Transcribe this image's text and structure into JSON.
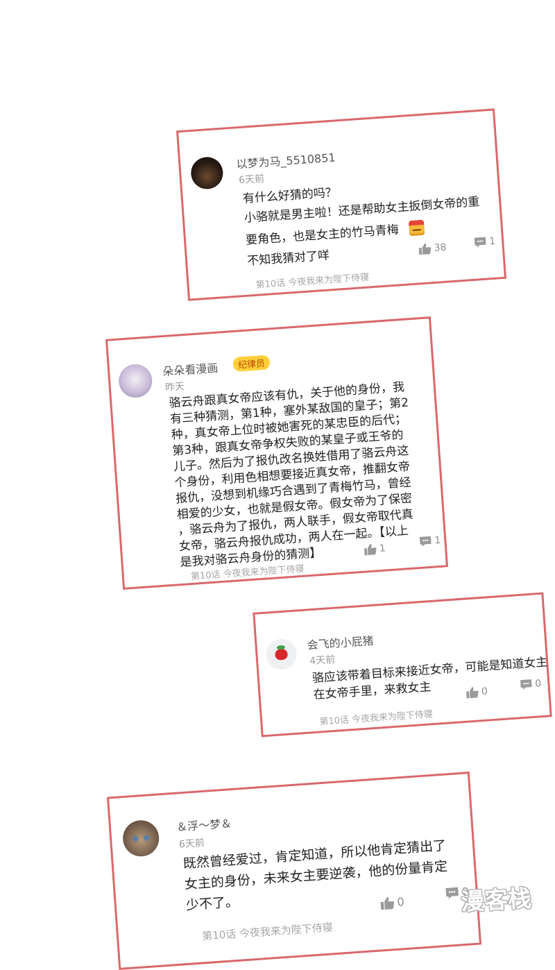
{
  "comments": [
    {
      "username": "以梦为马_5510851",
      "time": "6天前",
      "lines": [
        "有什么好猜的吗？",
        "小骆就是男主啦！还是帮助女主扳倒女帝的重",
        "要角色，也是女主的竹马青梅",
        "不知我猜对了咩"
      ],
      "emoji": "smirk-emoji",
      "chapter": "第10话 今夜我来为陛下侍寝",
      "likes": "38",
      "replies": "1"
    },
    {
      "username": "朵朵看漫画",
      "badge": "纪律员",
      "time": "昨天",
      "lines": [
        "骆云舟跟真女帝应该有仇，关于他的身份，我",
        "有三种猜测，第1种，塞外某敌国的皇子；第2",
        "种，真女帝上位时被她害死的某忠臣的后代；",
        "第3种，跟真女帝争权失败的某皇子或王爷的",
        "儿子。然后为了报仇改名换姓借用了骆云舟这",
        "个身份，利用色相想要接近真女帝，推翻女帝",
        "报仇，没想到机缘巧合遇到了青梅竹马，曾经",
        "相爱的少女，也就是假女帝。假女帝为了保密",
        "，骆云舟为了报仇，两人联手，假女帝取代真",
        "女帝，骆云舟报仇成功，两人在一起。【以上",
        "是我对骆云舟身份的猜测】"
      ],
      "chapter": "第10话 今夜我来为陛下侍寝",
      "likes": "1",
      "replies": "1"
    },
    {
      "username": "会飞的小屁猪",
      "time": "4天前",
      "lines": [
        "骆应该带着目标来接近女帝，可能是知道女主",
        "在女帝手里，来救女主"
      ],
      "chapter": "第10话 今夜我来为陛下侍寝",
      "likes": "0",
      "replies": "0"
    },
    {
      "username": "＆浮～梦＆",
      "time": "6天前",
      "lines": [
        "既然曾经爱过，肯定知道，所以他肯定猜出了",
        "女主的身份，未来女主要逆袭，他的份量肯定",
        "少不了。"
      ],
      "chapter": "第10话 今夜我来为陛下侍寝",
      "likes": "0",
      "replies": "0"
    }
  ],
  "watermark": "漫客栈",
  "colors": {
    "border": "#d9686a",
    "badge": "#ffcf3a"
  }
}
